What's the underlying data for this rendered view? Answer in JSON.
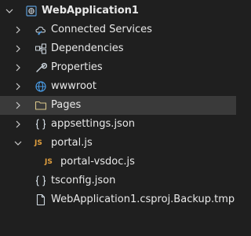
{
  "solution_explorer": {
    "project": {
      "label": "WebApplication1",
      "icon": "csharp-web-project-icon"
    },
    "items": [
      {
        "label": "Connected Services",
        "icon": "connected-services-icon",
        "expandable": true
      },
      {
        "label": "Dependencies",
        "icon": "dependencies-icon",
        "expandable": true
      },
      {
        "label": "Properties",
        "icon": "wrench-icon",
        "expandable": true
      },
      {
        "label": "wwwroot",
        "icon": "globe-icon",
        "expandable": true
      },
      {
        "label": "Pages",
        "icon": "folder-icon",
        "expandable": true,
        "selected": true
      },
      {
        "label": "appsettings.json",
        "icon": "json-icon",
        "expandable": true
      },
      {
        "label": "portal.js",
        "icon": "js-icon",
        "expandable": true,
        "expanded": true,
        "children": [
          {
            "label": "portal-vsdoc.js",
            "icon": "js-icon"
          }
        ]
      },
      {
        "label": "tsconfig.json",
        "icon": "json-icon",
        "expandable": false
      },
      {
        "label": "WebApplication1.csproj.Backup.tmp",
        "icon": "file-icon",
        "expandable": false
      }
    ],
    "colors": {
      "background": "#1f1f1f",
      "selection": "#3a3a3a",
      "text": "#e8e8e8",
      "chevron": "#cccccc",
      "js": "#e2a03f",
      "globe": "#4a9eea",
      "project": "#5b9bd5"
    }
  }
}
